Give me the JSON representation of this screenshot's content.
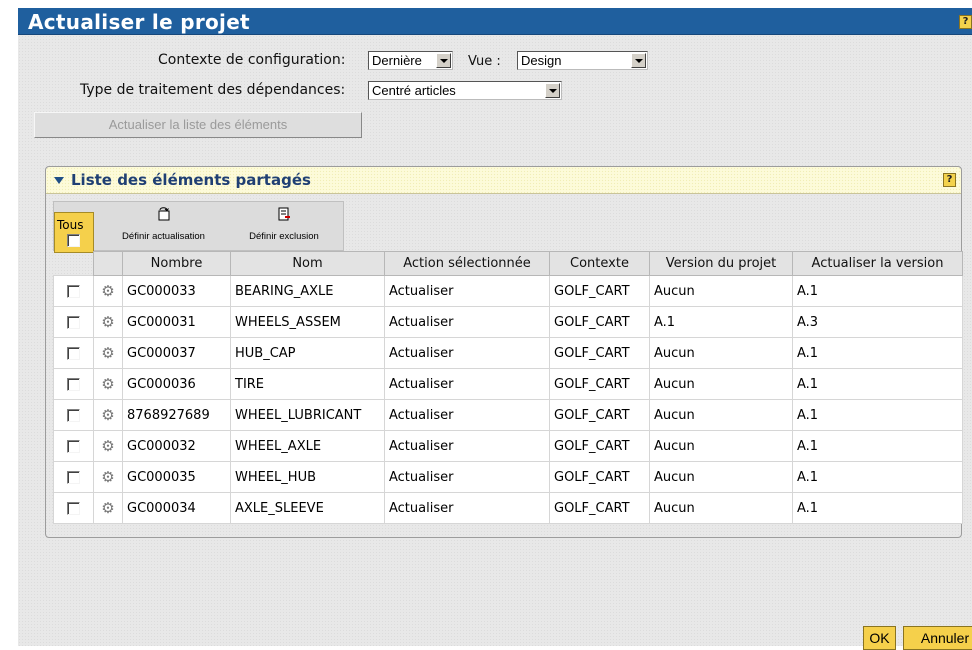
{
  "window": {
    "title": "Actualiser le projet",
    "help_label": "?"
  },
  "form": {
    "context_label": "Contexte de configuration:",
    "context_value": "Dernière",
    "view_label": "Vue :",
    "view_value": "Design",
    "dependency_label": "Type de traitement des dépendances:",
    "dependency_value": "Centré articles",
    "refresh_list_label": "Actualiser la liste des éléments"
  },
  "panel": {
    "title": "Liste des éléments partagés",
    "help_label": "?",
    "select_all_label": "Tous",
    "toolbar": {
      "set_update_label": "Définir actualisation",
      "set_exclusion_label": "Définir exclusion"
    }
  },
  "table": {
    "columns": [
      "Nombre",
      "Nom",
      "Action sélectionnée",
      "Contexte",
      "Version du projet",
      "Actualiser la version"
    ],
    "rows": [
      [
        "GC000033",
        "BEARING_AXLE",
        "Actualiser",
        "GOLF_CART",
        "Aucun",
        "A.1"
      ],
      [
        "GC000031",
        "WHEELS_ASSEM",
        "Actualiser",
        "GOLF_CART",
        "A.1",
        "A.3"
      ],
      [
        "GC000037",
        "HUB_CAP",
        "Actualiser",
        "GOLF_CART",
        "Aucun",
        "A.1"
      ],
      [
        "GC000036",
        "TIRE",
        "Actualiser",
        "GOLF_CART",
        "Aucun",
        "A.1"
      ],
      [
        "8768927689",
        "WHEEL_LUBRICANT",
        "Actualiser",
        "GOLF_CART",
        "Aucun",
        "A.1"
      ],
      [
        "GC000032",
        "WHEEL_AXLE",
        "Actualiser",
        "GOLF_CART",
        "Aucun",
        "A.1"
      ],
      [
        "GC000035",
        "WHEEL_HUB",
        "Actualiser",
        "GOLF_CART",
        "Aucun",
        "A.1"
      ],
      [
        "GC000034",
        "AXLE_SLEEVE",
        "Actualiser",
        "GOLF_CART",
        "Aucun",
        "A.1"
      ]
    ]
  },
  "footer": {
    "ok_label": "OK",
    "cancel_label": "Annuler"
  },
  "colors": {
    "title_bar": "#1f5f9e",
    "accent_button": "#f5d04b",
    "panel_header": "#fdfbd9"
  }
}
